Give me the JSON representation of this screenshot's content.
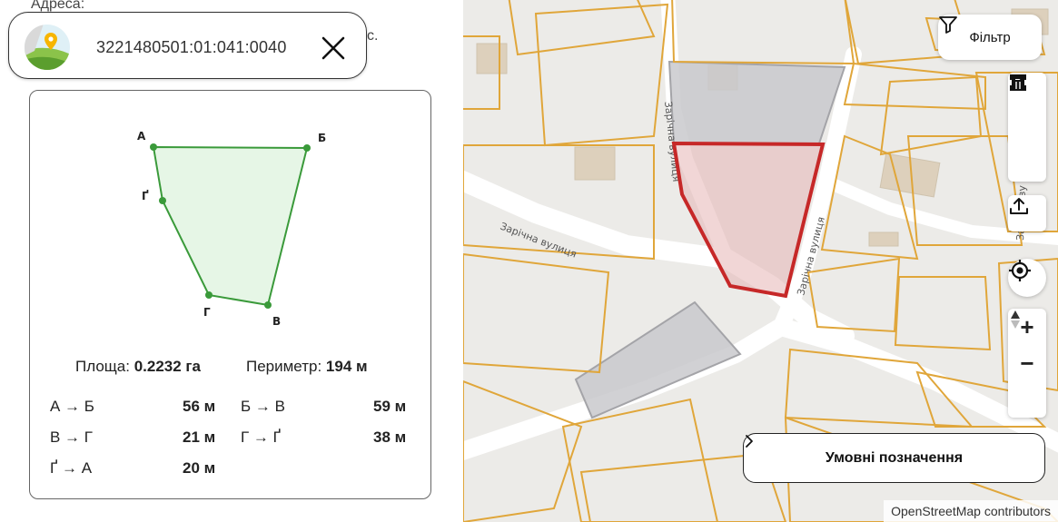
{
  "background_text": {
    "address_label": "Адреса:",
    "partial_text": "с."
  },
  "search": {
    "value": "3221480501:01:041:0040",
    "logo_icon": "map-pin-logo-icon",
    "close_icon": "close-icon"
  },
  "parcel": {
    "vertices": [
      {
        "name": "А"
      },
      {
        "name": "Б"
      },
      {
        "name": "В"
      },
      {
        "name": "Г"
      },
      {
        "name": "Ґ"
      }
    ],
    "area_label": "Площа:",
    "area_value": "0.2232 га",
    "perimeter_label": "Периметр:",
    "perimeter_value": "194 м",
    "segments": [
      {
        "label": "А → Б",
        "value": "56 м"
      },
      {
        "label": "Б → В",
        "value": "59 м"
      },
      {
        "label": "В → Г",
        "value": "21 м"
      },
      {
        "label": "Г → Ґ",
        "value": "38 м"
      },
      {
        "label": "Ґ → А",
        "value": "20 м"
      }
    ],
    "fill_color": "#e6f6e6",
    "stroke_color": "#3a9a3a"
  },
  "map": {
    "street_labels": [
      "Зарічна вулиця",
      "Зарічна вулиця",
      "Зарічна вулиця",
      "Зарічна ву"
    ],
    "filter_label": "Фільтр",
    "tools": [
      "line-draw-icon",
      "polygon-draw-icon",
      "trash-icon",
      "upload-icon",
      "locate-icon"
    ],
    "zoom_in": "+",
    "zoom_out": "−",
    "legend_label": "Умовні позначення",
    "attribution": "OpenStreetMap contributors",
    "colors": {
      "parcel_border": "#e0a63a",
      "selected_parcel": "#c62828",
      "road": "#ffffff",
      "building": "#ddd0bc",
      "gray_parcel": "#c9c9cc"
    }
  }
}
